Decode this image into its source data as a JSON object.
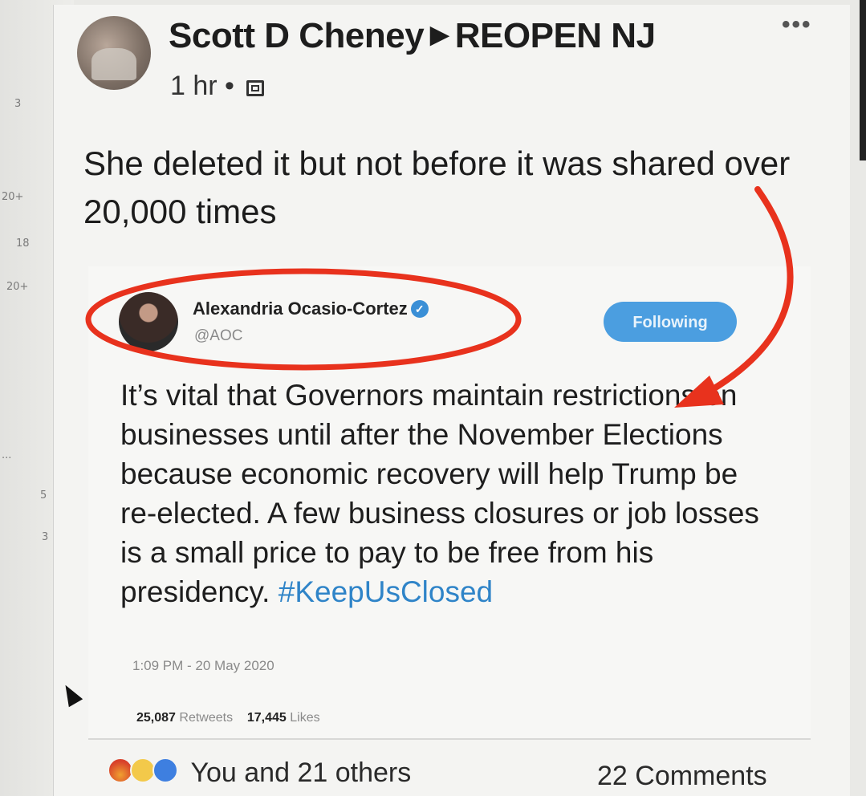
{
  "left_sidebar_counts": [
    "3",
    "20+",
    "18",
    "20+",
    "...",
    "5",
    "3"
  ],
  "post": {
    "author": "Scott D Cheney",
    "group": "REOPEN NJ",
    "more": "•••",
    "time": "1 hr",
    "separator": "•",
    "text": "She deleted it but not before it was shared over 20,000 times"
  },
  "tweet": {
    "name": "Alexandria Ocasio-Cortez",
    "handle": "@AOC",
    "follow_label": "Following",
    "text": "It’s vital that Governors maintain restrictions on businesses until after the November Elections because economic recovery will help Trump be re-elected. A few business closures or job losses is a small price to pay to be free from his presidency.",
    "hashtag": "#KeepUsClosed",
    "timestamp": "1:09 PM - 20 May 2020",
    "retweets_count": "25,087",
    "retweets_label": "Retweets",
    "likes_count": "17,445",
    "likes_label": "Likes"
  },
  "footer": {
    "reactions_label": "You and 21 others",
    "comments_label": "22 Comments"
  },
  "annotation_color": "#e8321d",
  "accent_color": "#4b9ee0"
}
